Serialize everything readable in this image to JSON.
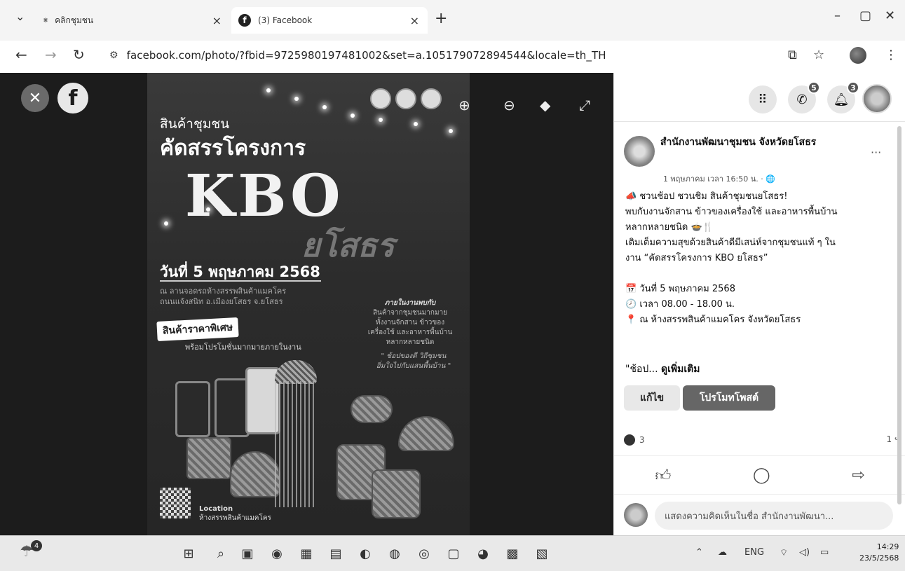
{
  "browser": {
    "tabs": [
      {
        "label": "คลิกชุมชน",
        "close": "×"
      },
      {
        "label": "(3) Facebook",
        "close": "×"
      }
    ],
    "new_tab": "+",
    "window_controls": {
      "minimize": "–",
      "maximize": "▢",
      "close": "✕"
    },
    "url": "facebook.com/photo/?fbid=972598019748100​2&set=a.105179072894544&locale=th_TH",
    "icons": [
      "back-icon",
      "forward-icon",
      "reload-icon",
      "site-info-icon",
      "install-icon",
      "bookmark-star-icon",
      "profile-icon",
      "menu-icon"
    ]
  },
  "viewer": {
    "close_label": "✕",
    "fb_label": "f",
    "tools": [
      "zoom-in-icon",
      "zoom-out-icon",
      "tag-icon",
      "fullscreen-icon"
    ]
  },
  "poster": {
    "subtitle": "สินค้าชุมชน",
    "headline": "คัดสรรโครงการ",
    "kbo": "KBO",
    "province_script": "ยโสธร",
    "date": "วันที่ 5 พฤษภาคม 2568",
    "venue_lines": [
      "ณ ลานจอดรถห้างสรรพสินค้าแมคโคร",
      "ถนนแจ้งสนิท อ.เมืองยโสธร จ.ยโสธร"
    ],
    "special_price": "สินค้าราคาพิเศษ",
    "promo": "พร้อมโปรโมชั่นมากมายภายในงาน",
    "inner_heading": "ภายในงานพบกับ",
    "inner_lines": [
      "สินค้าจากชุมชนมากมาย",
      "ทั้งงานจักสาน ข้าวของ",
      "เครื่องใช้ และอาหารพื้นบ้าน",
      "หลากหลายชนิด"
    ],
    "quote_lines": [
      "\" ช้อปของดี วิถีชุมชน",
      "อิ่มใจไปกับแสนพื้นบ้าน \""
    ],
    "location_title": "Location",
    "location_name": "ห้างสรรพสินค้าแมคโคร"
  },
  "panel": {
    "messenger_badge": "5",
    "notif_badge": "3",
    "page_name": "สำนักงานพัฒนาชุมชน จังหวัดยโสธร",
    "post_time": "1 พฤษภาคม เวลา 16:50 น. · 🌐",
    "more": "···",
    "body_lines": [
      "📣 ชวนช้อป ชวนชิม สินค้าชุมชนยโสธร!",
      "พบกับงานจักสาน ข้าวของเครื่องใช้ และอาหารพื้นบ้าน",
      "หลากหลายชนิด 🍲🍴",
      "เติมเต็มความสุขด้วยสินค้าดีมีเสน่ห์จากชุมชนแท้ ๆ ใน",
      "งาน “คัดสรรโครงการ KBO ยโสธร”",
      "",
      "📅 วันที่ 5 พฤษภาคม 2568",
      "🕗 เวลา 08.00 - 18.00 น.",
      "📍 ณ ห้างสรรพสินค้าแมคโคร จังหวัดยโสธร"
    ],
    "see_more_prefix": "\"ช้อป... ",
    "see_more": "ดูเพิ่มเติม",
    "edit_label": "แก้ไข",
    "promote_label": "โปรโมทโพสต์",
    "like_count": "3",
    "share_count": "1",
    "comment_placeholder": "แสดงความคิดเห็นในชื่อ สำนักงานพัฒนา..."
  },
  "taskbar": {
    "weather_badge": "4",
    "tray_lang": "ENG",
    "clock_time": "14:29",
    "clock_date": "23/5/2568"
  }
}
